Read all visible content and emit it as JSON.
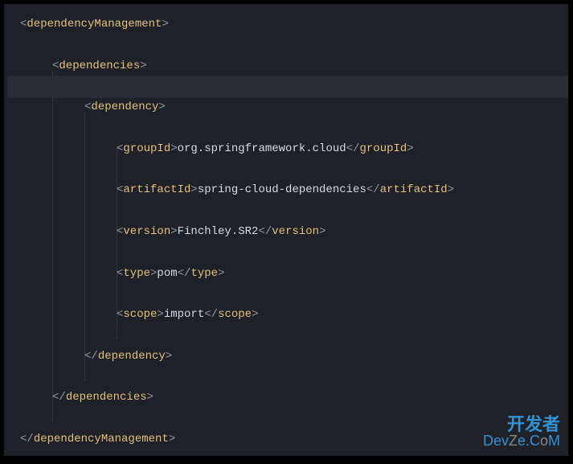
{
  "tags": {
    "dependencyManagement_open": "dependencyManagement",
    "dependencyManagement_close": "dependencyManagement",
    "dependencies_open": "dependencies",
    "dependencies_close": "dependencies",
    "dependency_open": "dependency",
    "dependency_close": "dependency",
    "groupId_open": "groupId",
    "groupId_close": "groupId",
    "artifactId_open": "artifactId",
    "artifactId_close": "artifactId",
    "version_open": "version",
    "version_close": "version",
    "type_open": "type",
    "type_close": "type",
    "scope_open": "scope",
    "scope_close": "scope"
  },
  "values": {
    "groupId": "org.springframework.cloud",
    "artifactId": "spring-cloud-dependencies",
    "version": "Finchley.SR2",
    "type": "pom",
    "scope": "import"
  },
  "watermark": {
    "line1": "开发者",
    "line2a": "Dev",
    "line2b": "Z",
    "line2c": "e",
    "line2d": ".C",
    "line2e": "o",
    "line2f": "M"
  }
}
